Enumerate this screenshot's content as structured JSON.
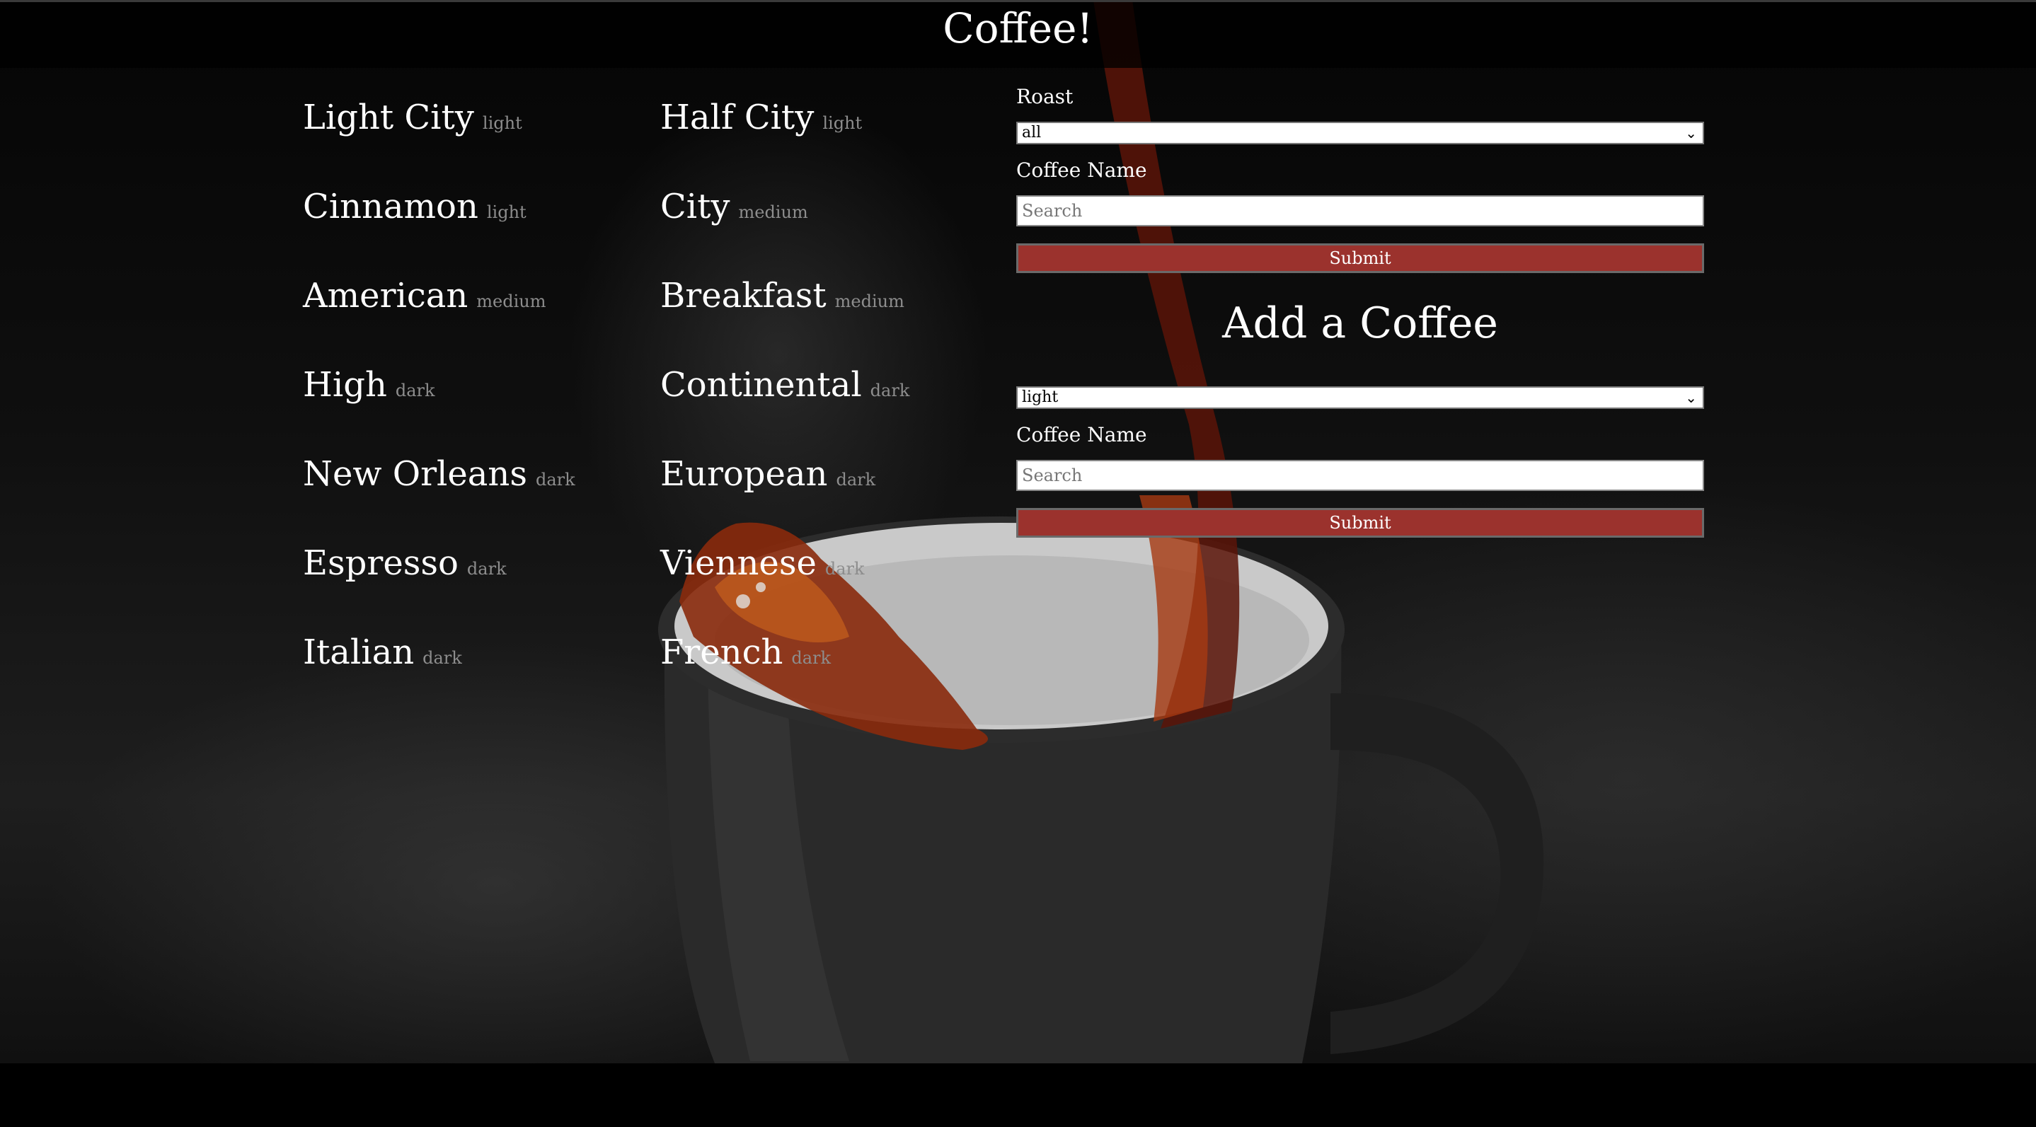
{
  "header": {
    "title": "Coffee!"
  },
  "coffees": [
    {
      "name": "Light City",
      "roast": "light"
    },
    {
      "name": "Half City",
      "roast": "light"
    },
    {
      "name": "Cinnamon",
      "roast": "light"
    },
    {
      "name": "City",
      "roast": "medium"
    },
    {
      "name": "American",
      "roast": "medium"
    },
    {
      "name": "Breakfast",
      "roast": "medium"
    },
    {
      "name": "High",
      "roast": "dark"
    },
    {
      "name": "Continental",
      "roast": "dark"
    },
    {
      "name": "New Orleans",
      "roast": "dark"
    },
    {
      "name": "European",
      "roast": "dark"
    },
    {
      "name": "Espresso",
      "roast": "dark"
    },
    {
      "name": "Viennese",
      "roast": "dark"
    },
    {
      "name": "Italian",
      "roast": "dark"
    },
    {
      "name": "French",
      "roast": "dark"
    }
  ],
  "filter_form": {
    "roast_label": "Roast",
    "roast_selected": "all",
    "name_label": "Coffee Name",
    "name_placeholder": "Search",
    "submit_label": "Submit"
  },
  "add_form": {
    "title": "Add a Coffee",
    "roast_selected": "light",
    "name_label": "Coffee Name",
    "name_placeholder": "Search",
    "submit_label": "Submit"
  },
  "colors": {
    "submit_button": "#9b322d",
    "roast_text": "#8d8d8d"
  }
}
